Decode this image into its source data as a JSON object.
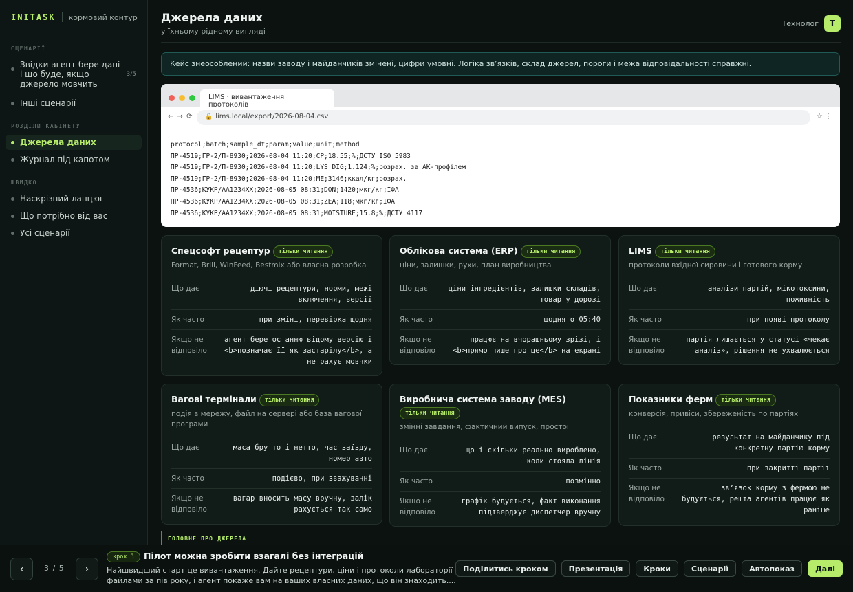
{
  "brand": {
    "logo": "INITASK",
    "subtitle": "кормовий контур"
  },
  "sidebar": {
    "scenarios_label": "СЦЕНАРІЇ",
    "scenarios": [
      {
        "label": "Звідки агент бере дані і що буде, якщо джерело мовчить",
        "count": "3/5"
      },
      {
        "label": "Інші сценарії"
      }
    ],
    "sections_label": "РОЗДІЛИ КАБІНЕТУ",
    "sections": [
      {
        "label": "Джерела даних",
        "active": true
      },
      {
        "label": "Журнал під капотом"
      }
    ],
    "quick_label": "ШВИДКО",
    "quick": [
      {
        "label": "Наскрізний ланцюг"
      },
      {
        "label": "Що потрібно від вас"
      },
      {
        "label": "Усі сценарії"
      }
    ]
  },
  "header": {
    "title": "Джерела даних",
    "subtitle": "у їхньому рідному вигляді",
    "role": "Технолог",
    "avatar": "Т"
  },
  "notice": "Кейс знеособлений: назви заводу і майданчиків змінені, цифри умовні. Логіка зв’язків, склад джерел, пороги і межа відповідальності справжні.",
  "browser": {
    "tab": "LIMS · вивантаження протоколів",
    "nav": "← → ⟳",
    "url": "lims.local/export/2026-08-04.csv",
    "icons": "☆ ⋮",
    "csv_lines": [
      "protocol;batch;sample_dt;param;value;unit;method",
      "ПР-4519;ГР-2/П-8930;2026-08-04 11:20;CP;18.55;%;ДСТУ ISO 5983",
      "ПР-4519;ГР-2/П-8930;2026-08-04 11:20;LYS_DIG;1.124;%;розрах. за АК-профілем",
      "ПР-4519;ГР-2/П-8930;2026-08-04 11:20;ME;3146;ккал/кг;розрах.",
      "ПР-4536;КУКР/АА1234ХХ;2026-08-05 08:31;DON;1420;мкг/кг;ІФА",
      "ПР-4536;КУКР/АА1234ХХ;2026-08-05 08:31;ZEA;118;мкг/кг;ІФА",
      "ПР-4536;КУКР/АА1234ХХ;2026-08-05 08:31;MOISTURE;15.8;%;ДСТУ 4117"
    ]
  },
  "row_labels": {
    "gives": "Що дає",
    "how_often": "Як часто",
    "no_answer": "Якщо не відповіло"
  },
  "cards": [
    {
      "title": "Спецсофт рецептур",
      "badge": "тільки читання",
      "subtitle": "Format, Brill, WinFeed, Bestmix або власна розробка",
      "gives": "діючі рецептури, норми, межі включення, версії",
      "how_often": "при зміні, перевірка щодня",
      "no_answer": "агент бере останню відому версію і <b>позначає її як застарілу</b>, а не рахує мовчки"
    },
    {
      "title": "Облікова система (ERP)",
      "badge": "тільки читання",
      "subtitle": "ціни, залишки, рухи, план виробництва",
      "gives": "ціни інгредієнтів, залишки складів, товар у дорозі",
      "how_often": "щодня о 05:40",
      "no_answer": "працює на вчорашньому зрізі, і <b>прямо пише про це</b> на екрані"
    },
    {
      "title": "LIMS",
      "badge": "тільки читання",
      "subtitle": "протоколи вхідної сировини і готового корму",
      "gives": "аналізи партій, мікотоксини, поживність",
      "how_often": "при появі протоколу",
      "no_answer": "партія лишається у статусі «чекає аналіз», рішення не ухвалюється"
    },
    {
      "title": "Вагові термінали",
      "badge": "тільки читання",
      "subtitle": "подія в мережу, файл на сервері або база вагової програми",
      "gives": "маса брутто і нетто, час заїзду, номер авто",
      "how_often": "подієво, при зважуванні",
      "no_answer": "вагар вносить масу вручну, залік рахується так само"
    },
    {
      "title": "Виробнича система заводу (MES)",
      "badge": "тільки читання",
      "subtitle": "змінні завдання, фактичний випуск, простої",
      "gives": "що і скільки реально вироблено, коли стояла лінія",
      "how_often": "позмінно",
      "no_answer": "графік будується, факт виконання підтверджує диспетчер вручну"
    },
    {
      "title": "Показники ферм",
      "badge": "тільки читання",
      "subtitle": "конверсія, привіси, збереженість по партіях",
      "gives": "результат на майданчику під конкретну партію корму",
      "how_often": "при закритті партії",
      "no_answer": "зв’язок корму з фермою не будується, решта агентів працює як раніше"
    }
  ],
  "section_tag": "ГОЛОВНЕ ПРО ДЖЕРЕЛА",
  "footer": {
    "prev": "‹",
    "next": "›",
    "pager": "3 / 5",
    "step_badge": "крок 3",
    "step_title": "Пілот можна зробити взагалі без інтеграцій",
    "step_text": "Найшвидший старт це вивантаження. Дайте рецептури, ціни і протоколи лабораторії файлами за пів року, і агент покаже вам на ваших власних даних, що він знаходить....",
    "actions": [
      "Поділитись кроком",
      "Презентація",
      "Кроки",
      "Сценарії",
      "Автопоказ"
    ],
    "primary": "Далі"
  },
  "colors": {
    "accent": "#b6ec6a",
    "background": "#0b1210",
    "card": "#111b18",
    "notice_border": "#1f5a55"
  }
}
